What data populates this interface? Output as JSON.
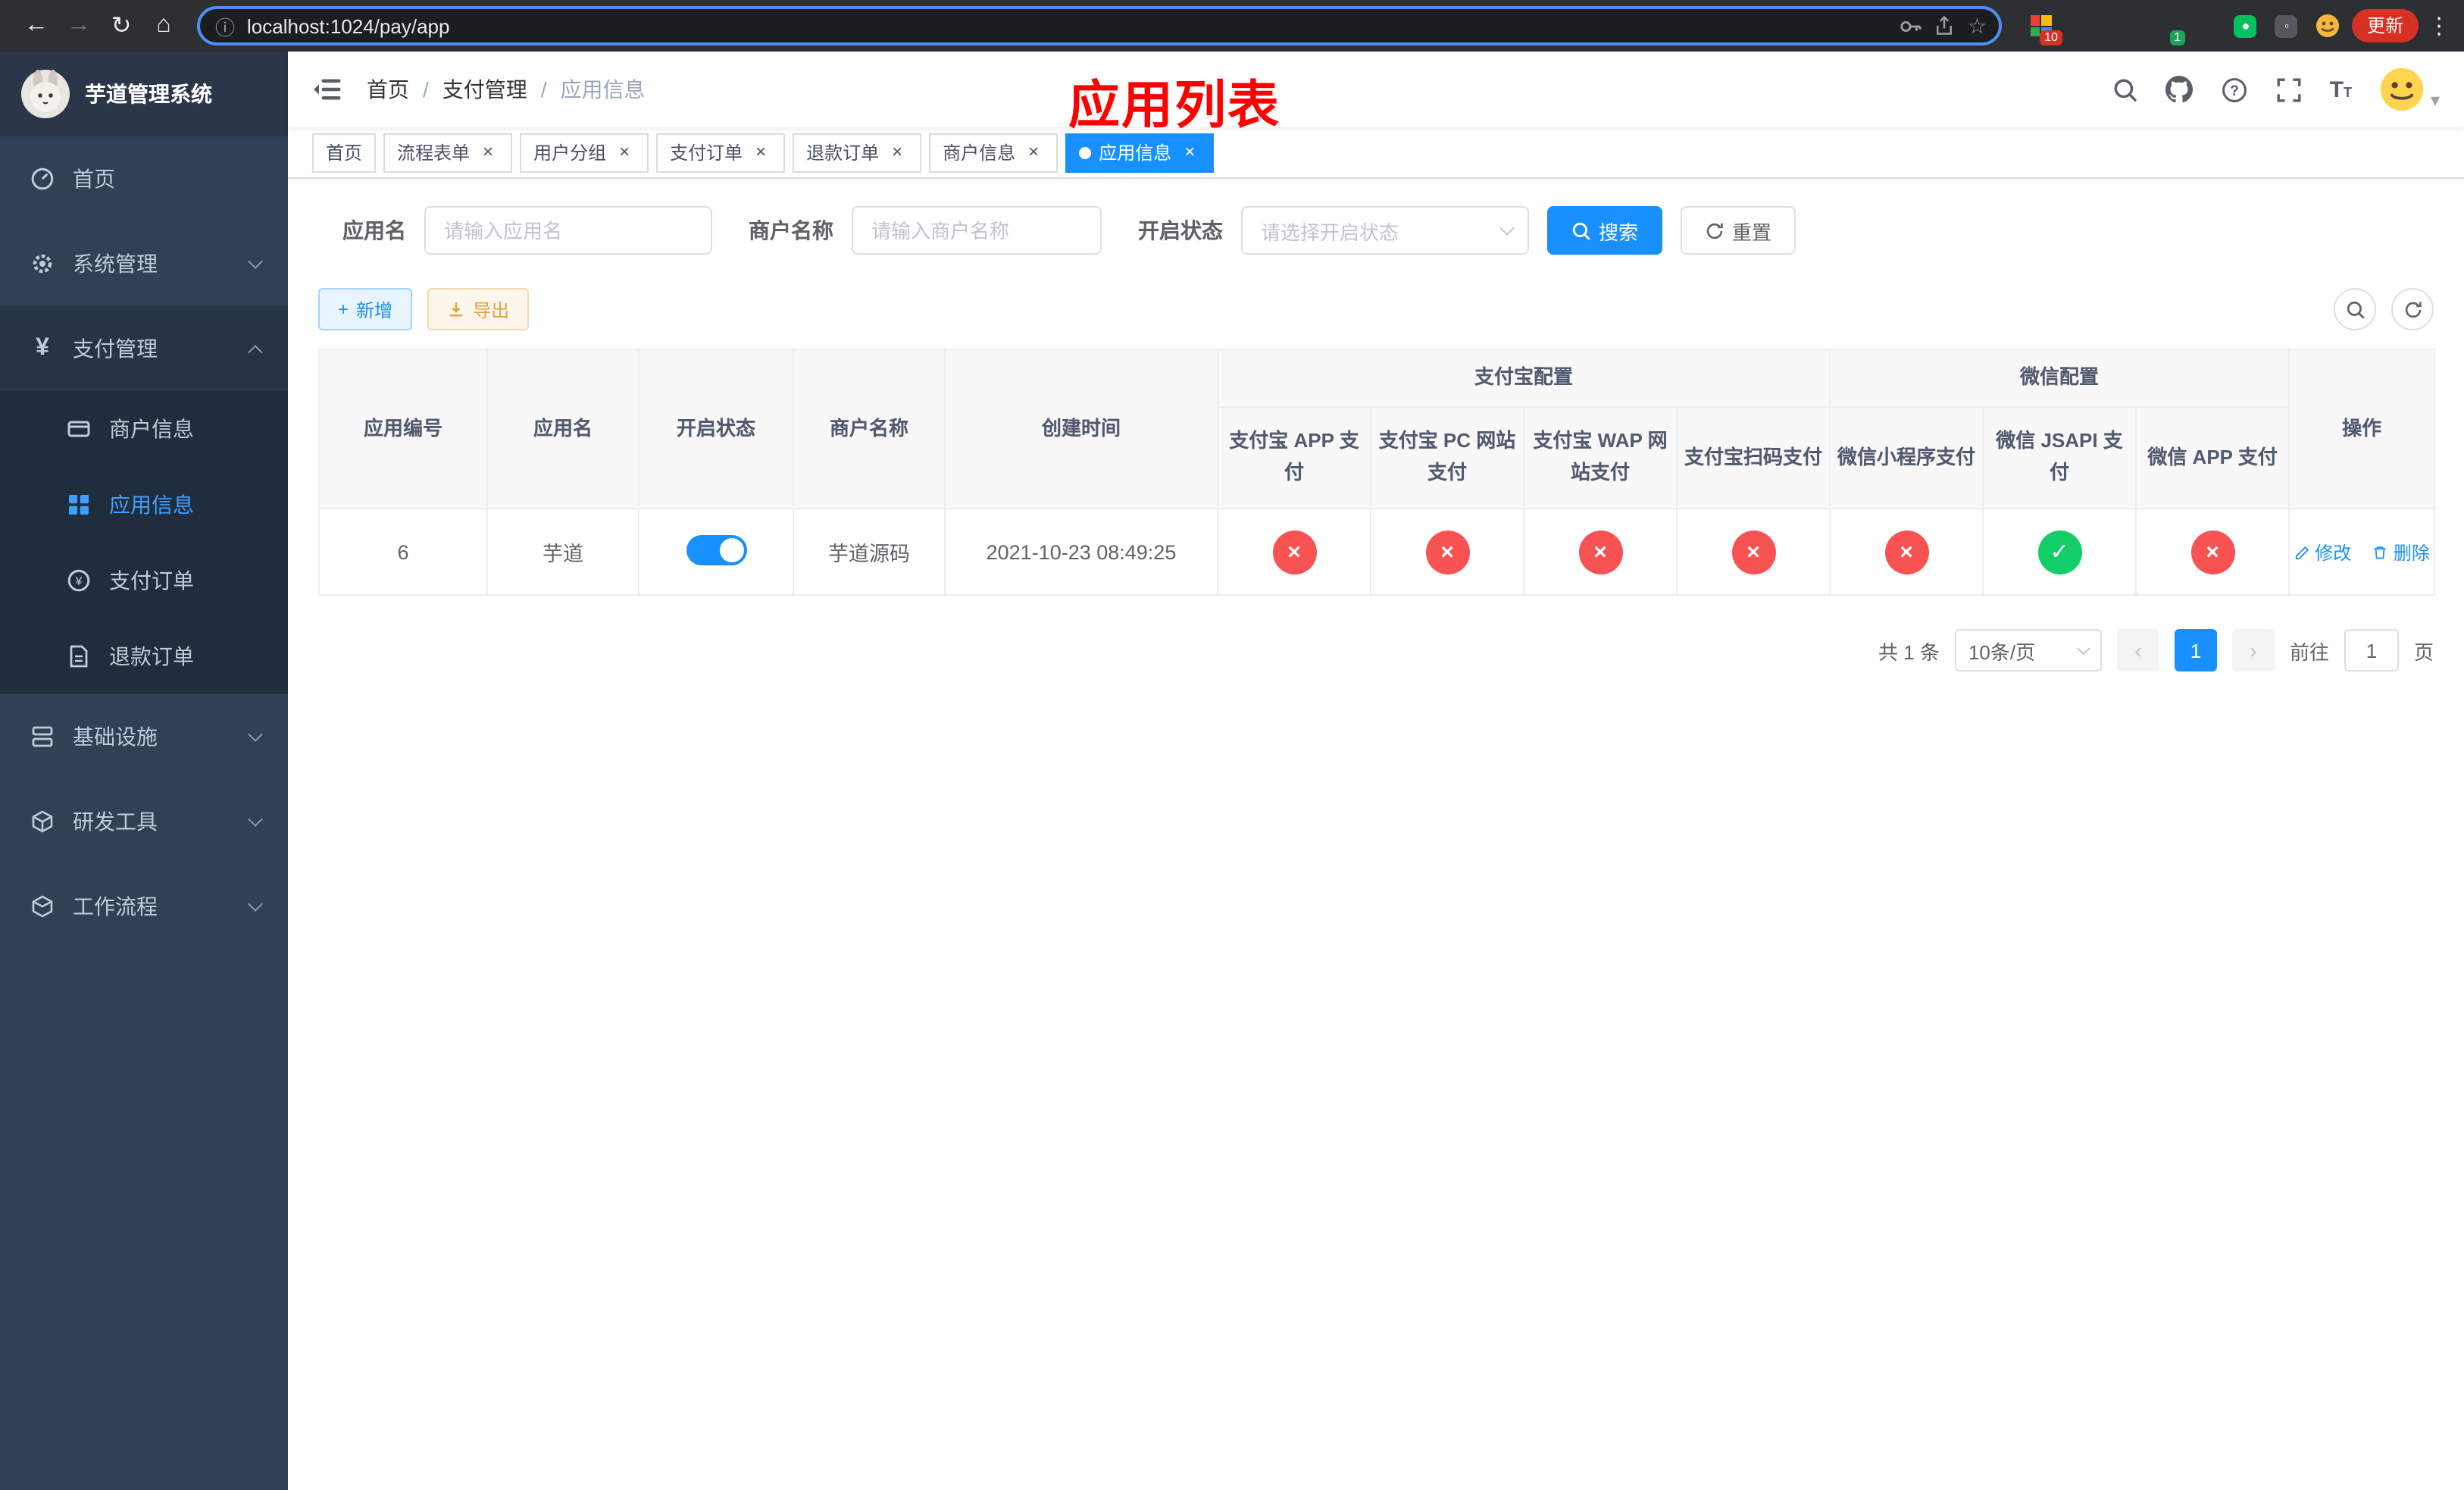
{
  "browser": {
    "url": "localhost:1024/pay/app",
    "update_label": "更新",
    "ext_badge_count": "10",
    "profile_badge_count": "1"
  },
  "icons": {
    "back": "←",
    "forward": "→",
    "reload": "↻",
    "home": "⌂",
    "info": "ⓘ",
    "star": "☆",
    "menu": "⋮",
    "plus": "+",
    "close": "×",
    "check": "✓",
    "cross": "×",
    "caret": "▾",
    "yen": "¥",
    "font_size": "T"
  },
  "colors": {
    "primary": "#1890ff",
    "sidebar_active": "#409eff",
    "success": "#13ce66",
    "danger": "#f85252",
    "warning": "#e6a23c",
    "annotation_red": "#ff0000"
  },
  "sidebar": {
    "app_title": "芋道管理系统",
    "menu": {
      "home": "首页",
      "system": "系统管理",
      "payment": "支付管理",
      "infra": "基础设施",
      "devtools": "研发工具",
      "workflow": "工作流程"
    },
    "payment_children": {
      "merchant": "商户信息",
      "app": "应用信息",
      "order": "支付订单",
      "refund": "退款订单"
    }
  },
  "navbar": {
    "breadcrumb": [
      "首页",
      "支付管理",
      "应用信息"
    ],
    "separator": "/",
    "annotation": "应用列表"
  },
  "tabs": [
    {
      "label": "首页",
      "closable": false,
      "active": false
    },
    {
      "label": "流程表单",
      "closable": true,
      "active": false
    },
    {
      "label": "用户分组",
      "closable": true,
      "active": false
    },
    {
      "label": "支付订单",
      "closable": true,
      "active": false
    },
    {
      "label": "退款订单",
      "closable": true,
      "active": false
    },
    {
      "label": "商户信息",
      "closable": true,
      "active": false
    },
    {
      "label": "应用信息",
      "closable": true,
      "active": true
    }
  ],
  "filters": {
    "app_name_label": "应用名",
    "app_name_placeholder": "请输入应用名",
    "merchant_label": "商户名称",
    "merchant_placeholder": "请输入商户名称",
    "status_label": "开启状态",
    "status_placeholder": "请选择开启状态",
    "search_button": "搜索",
    "reset_button": "重置"
  },
  "toolbar": {
    "add_button": "新增",
    "export_button": "导出"
  },
  "table": {
    "group_alipay": "支付宝配置",
    "group_wechat": "微信配置",
    "col_app_id": "应用编号",
    "col_app_name": "应用名",
    "col_status": "开启状态",
    "col_merchant": "商户名称",
    "col_created": "创建时间",
    "col_alipay_app": "支付宝 APP 支付",
    "col_alipay_pc": "支付宝 PC 网站支付",
    "col_alipay_wap": "支付宝 WAP 网站支付",
    "col_alipay_qr": "支付宝扫码支付",
    "col_wx_mini": "微信小程序支付",
    "col_wx_jsapi": "微信 JSAPI 支付",
    "col_wx_app": "微信 APP 支付",
    "col_ops": "操作",
    "row": {
      "id": "6",
      "name": "芋道",
      "status_on": true,
      "merchant": "芋道源码",
      "created": "2021-10-23 08:49:25",
      "alipay_app": "no",
      "alipay_pc": "no",
      "alipay_wap": "no",
      "alipay_qr": "no",
      "wx_mini": "no",
      "wx_jsapi": "yes",
      "wx_app": "no",
      "edit": "修改",
      "delete": "删除"
    }
  },
  "pagination": {
    "total": "共 1 条",
    "size": "10条/页",
    "prev": "‹",
    "page": "1",
    "next": "›",
    "goto_label": "前往",
    "goto_value": "1",
    "page_unit": "页"
  }
}
